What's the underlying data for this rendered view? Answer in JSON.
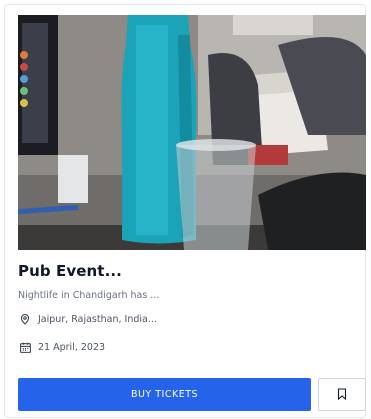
{
  "event": {
    "title": "Pub Event...",
    "description": "Nightlife in Chandigarh has ...",
    "location": "Jaipur, Rajasthan, India...",
    "date": "21 April, 2023"
  },
  "actions": {
    "buy_label": "BUY TICKETS",
    "bookmark_icon": "bookmark-icon"
  },
  "icons": {
    "location": "location-pin-icon",
    "date": "calendar-icon"
  },
  "colors": {
    "accent": "#2563eb",
    "title": "#111827",
    "muted": "#6b7280"
  }
}
